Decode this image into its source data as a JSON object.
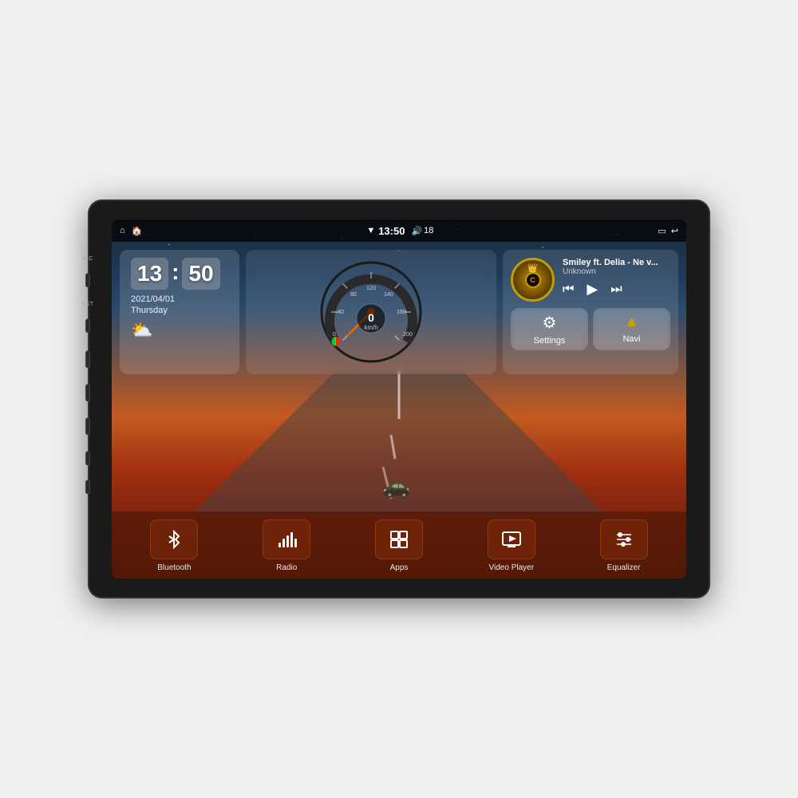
{
  "device": {
    "side_labels": {
      "mic": "MIC",
      "rst": "RST"
    }
  },
  "status_bar": {
    "home_icon": "⌂",
    "android_icon": "🏠",
    "wifi_icon": "▼",
    "time": "13:50",
    "volume_icon": "🔊",
    "volume_level": "18",
    "battery_icon": "▭",
    "back_icon": "↩"
  },
  "clock_widget": {
    "hour": "13",
    "minute": "50",
    "date": "2021/04/01",
    "day": "Thursday",
    "weather_icon": "⛅"
  },
  "speedometer": {
    "speed": "0",
    "unit": "km/h",
    "max": "240"
  },
  "music_widget": {
    "title": "Smiley ft. Delia - Ne v...",
    "artist": "Unknown",
    "prev_icon": "⏮",
    "play_icon": "▶",
    "next_icon": "⏭"
  },
  "quick_buttons": [
    {
      "id": "settings",
      "icon": "⚙",
      "label": "Settings"
    },
    {
      "id": "navi",
      "icon": "▲",
      "label": "Navi"
    }
  ],
  "bottom_menu": [
    {
      "id": "bluetooth",
      "icon": "✦",
      "label": "Bluetooth"
    },
    {
      "id": "radio",
      "icon": "📶",
      "label": "Radio"
    },
    {
      "id": "apps",
      "icon": "⊞",
      "label": "Apps"
    },
    {
      "id": "video-player",
      "icon": "📺",
      "label": "Video Player"
    },
    {
      "id": "equalizer",
      "icon": "⚌",
      "label": "Equalizer"
    }
  ],
  "side_buttons": [
    {
      "id": "home",
      "label": "⌂"
    },
    {
      "id": "back",
      "label": "↩"
    },
    {
      "id": "vol-up",
      "label": "+"
    },
    {
      "id": "vol-down",
      "label": "-"
    }
  ]
}
